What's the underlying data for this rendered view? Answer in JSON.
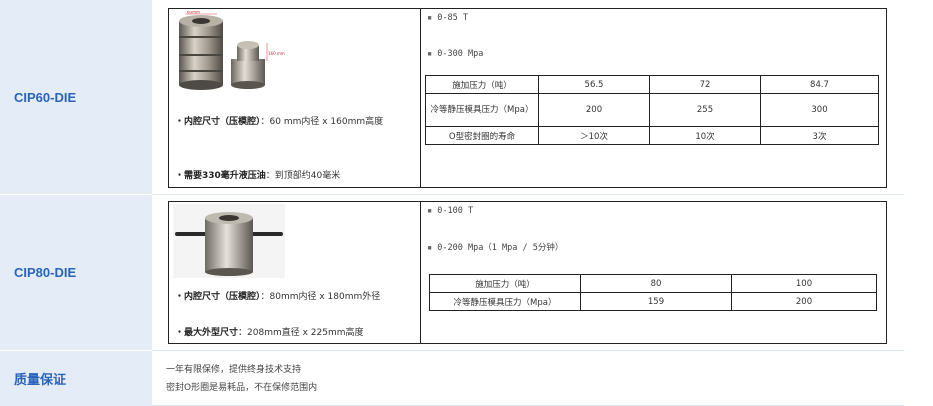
{
  "rows": [
    {
      "label": "CIP60-DIE",
      "cavity_label": "・内腔尺寸（压模腔）",
      "cavity_value": "：60 mm内径 x 160mm高度",
      "oil_label": "・需要330毫升液压油",
      "oil_value": "：到顶部约40毫米",
      "specs": [
        "0-85 T",
        "0-300 Mpa"
      ],
      "image_dims": [
        "60mm",
        "160 mm"
      ],
      "table": [
        [
          "施加压力（吨）",
          "56.5",
          "72",
          "84.7"
        ],
        [
          "冷等静压模具压力（Mpa）",
          "200",
          "255",
          "300"
        ],
        [
          "O型密封圈的寿命",
          "＞10次",
          "10次",
          "3次"
        ]
      ]
    },
    {
      "label": "CIP80-DIE",
      "cavity_label": "・内腔尺寸（压模腔）",
      "cavity_value": "：80mm内径 x 180mm外径",
      "size_label": "・最大外型尺寸",
      "size_value": "：208mm直径 x 225mm高度",
      "specs": [
        "0-100 T",
        "0-200 Mpa（1 Mpa / 5分钟）"
      ],
      "table": [
        [
          "施加压力（吨）",
          "80",
          "100"
        ],
        [
          "冷等静压模具压力（Mpa）",
          "159",
          "200"
        ]
      ]
    }
  ],
  "guarantee": {
    "label": "质量保证",
    "lines": [
      "一年有限保修，提供终身技术支持",
      "密封O形圈是易耗品，不在保修范围内"
    ]
  }
}
